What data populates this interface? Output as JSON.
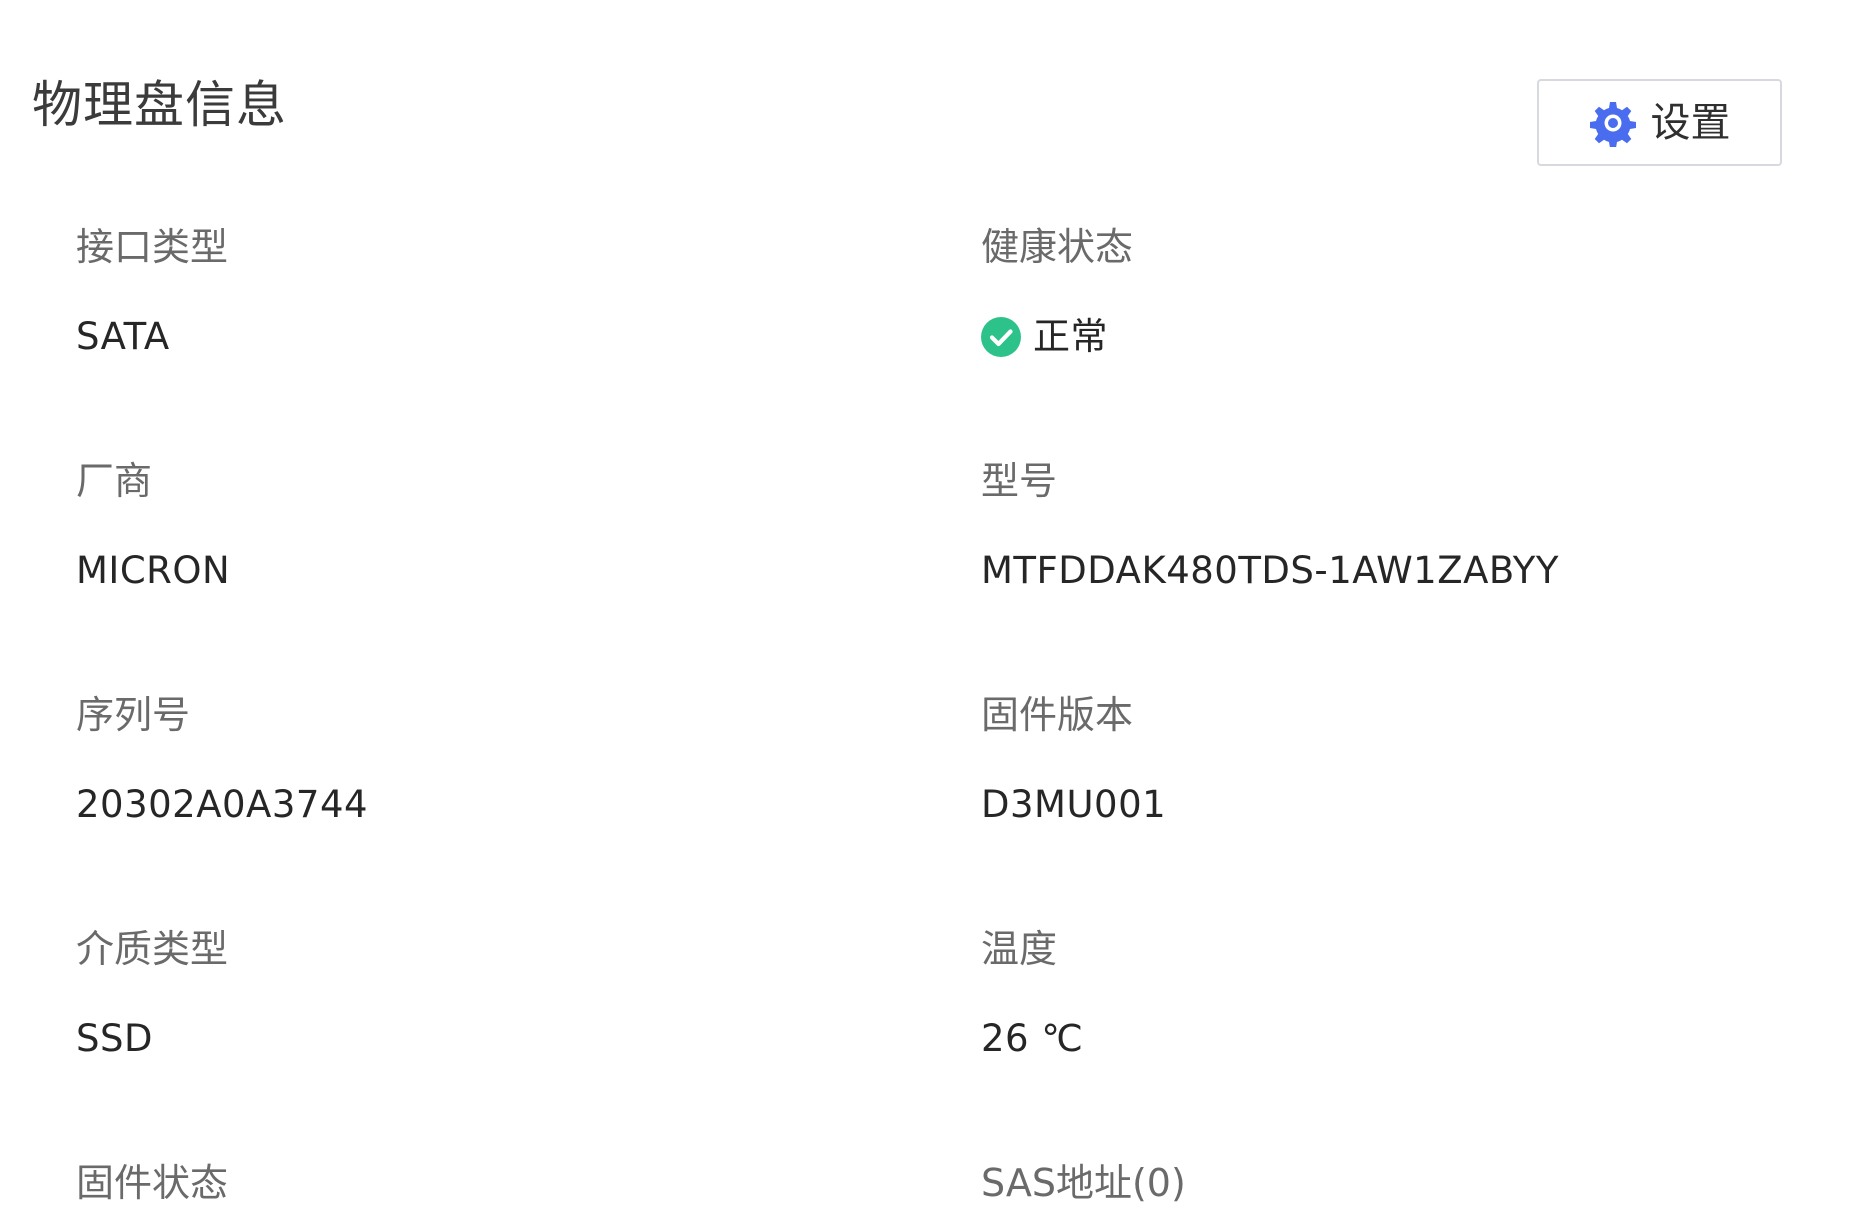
{
  "panel": {
    "title": "物理盘信息",
    "settings_button": {
      "icon": "gear-icon",
      "label": "设置"
    }
  },
  "fields": {
    "interface_type": {
      "label": "接口类型",
      "value": "SATA"
    },
    "health_status": {
      "label": "健康状态",
      "value": "正常",
      "status_icon": "check-circle-icon"
    },
    "vendor": {
      "label": "厂商",
      "value": "MICRON"
    },
    "model": {
      "label": "型号",
      "value": "MTFDDAK480TDS-1AW1ZABYY"
    },
    "serial_number": {
      "label": "序列号",
      "value": "20302A0A3744"
    },
    "firmware_version": {
      "label": "固件版本",
      "value": "D3MU001"
    },
    "media_type": {
      "label": "介质类型",
      "value": "SSD"
    },
    "temperature": {
      "label": "温度",
      "value": "26 ℃"
    },
    "firmware_status": {
      "label": "固件状态"
    },
    "sas_address": {
      "label": "SAS地址(0)"
    }
  },
  "colors": {
    "accent": "#4a6df0",
    "success": "#2dc28a",
    "label_text": "#6a6a6a",
    "value_text": "#262626",
    "border": "#d7d9de"
  }
}
